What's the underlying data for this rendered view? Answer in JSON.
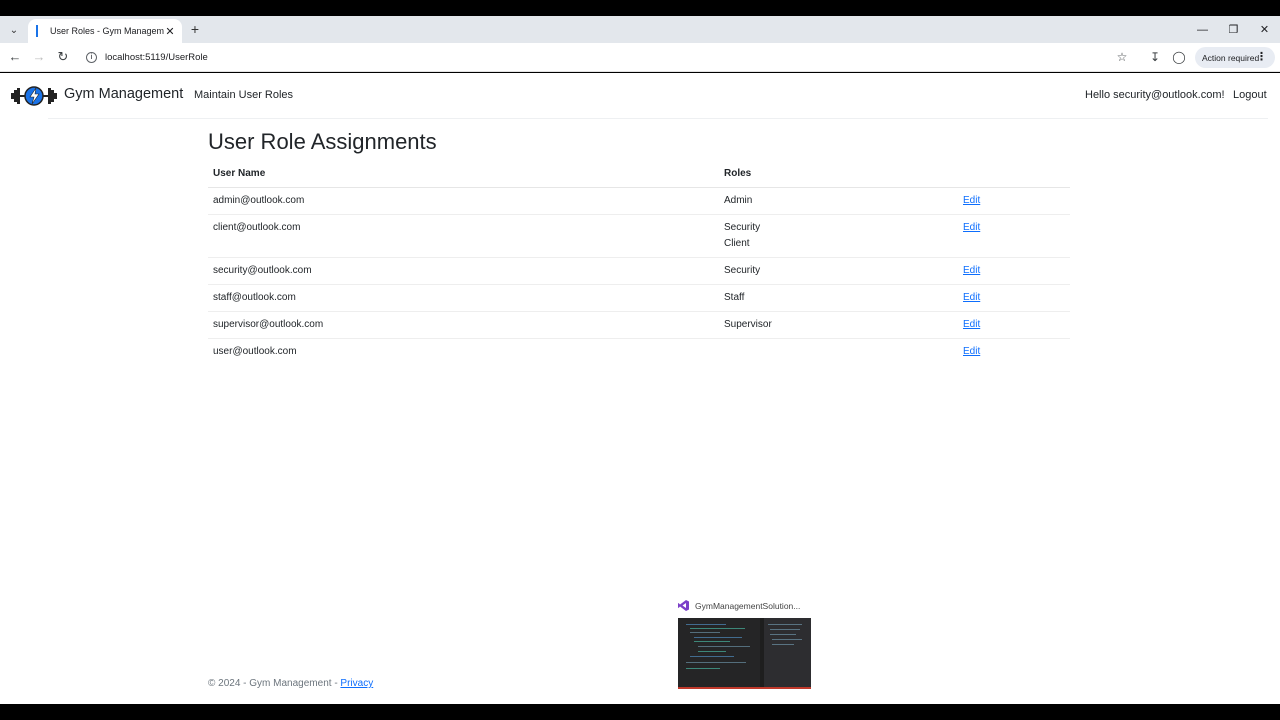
{
  "browser": {
    "tab_title": "User Roles - Gym Management",
    "url": "localhost:5119/UserRole",
    "action_required_label": "Action required"
  },
  "navbar": {
    "brand": "Gym Management",
    "nav_link": "Maintain User Roles",
    "greeting": "Hello security@outlook.com!",
    "logout": "Logout"
  },
  "page": {
    "title": "User Role Assignments"
  },
  "table": {
    "headers": {
      "user_name": "User Name",
      "roles": "Roles"
    },
    "rows": [
      {
        "user": "admin@outlook.com",
        "roles": [
          "Admin"
        ],
        "edit": "Edit"
      },
      {
        "user": "client@outlook.com",
        "roles": [
          "Security",
          "Client"
        ],
        "edit": "Edit"
      },
      {
        "user": "security@outlook.com",
        "roles": [
          "Security"
        ],
        "edit": "Edit"
      },
      {
        "user": "staff@outlook.com",
        "roles": [
          "Staff"
        ],
        "edit": "Edit"
      },
      {
        "user": "supervisor@outlook.com",
        "roles": [
          "Supervisor"
        ],
        "edit": "Edit"
      },
      {
        "user": "user@outlook.com",
        "roles": [],
        "edit": "Edit"
      }
    ]
  },
  "footer": {
    "text": "© 2024 - Gym Management - ",
    "privacy": "Privacy"
  },
  "taskbar_preview": {
    "title": "GymManagementSolution..."
  },
  "colors": {
    "link": "#0d6efd",
    "brand_logo_blue": "#1a73e8",
    "text": "#212529"
  }
}
